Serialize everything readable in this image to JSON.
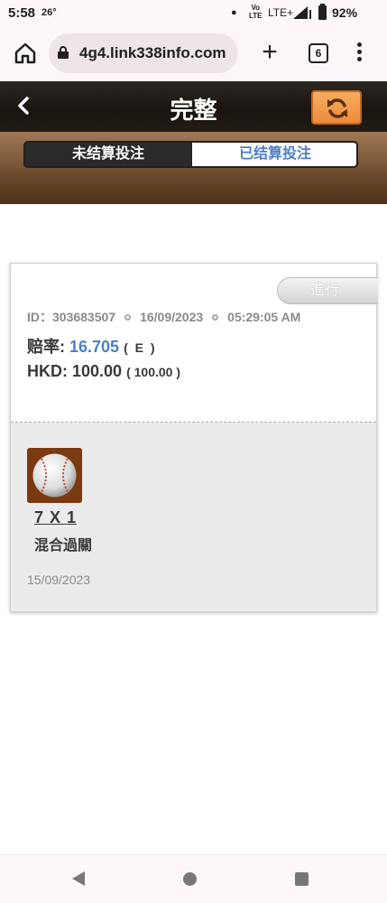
{
  "status_bar": {
    "time": "5:58",
    "temperature": "26°",
    "volte": "Vo\nLTE",
    "network": "LTE+",
    "battery": "92%"
  },
  "browser": {
    "url": "4g4.link338info.com",
    "tab_count": "6"
  },
  "header": {
    "title": "完整",
    "back_icon": "chevron-left-icon",
    "refresh_icon": "refresh-icon"
  },
  "tabs": {
    "unsettled": "未结算投注",
    "settled": "已结算投注",
    "active": "settled"
  },
  "bet": {
    "status": "進行",
    "id_label": "ID：",
    "id": "303683507",
    "date": "16/09/2023",
    "time": "05:29:05 AM",
    "odds_label": "赔率:",
    "odds_value": "16.705",
    "odds_type": "( E )",
    "stake_label": "HKD:",
    "stake_value": "100.00",
    "stake_paren": "( 100.00 )",
    "sport_icon": "baseball-icon",
    "combo": "7 X 1",
    "bet_type": "混合過關",
    "event_date": "15/09/2023"
  },
  "colors": {
    "accent_blue": "#4d7ec6",
    "refresh_orange": "#f29a48",
    "header_dark": "#1a140f",
    "tabs_brown": "#6c4a2c"
  }
}
